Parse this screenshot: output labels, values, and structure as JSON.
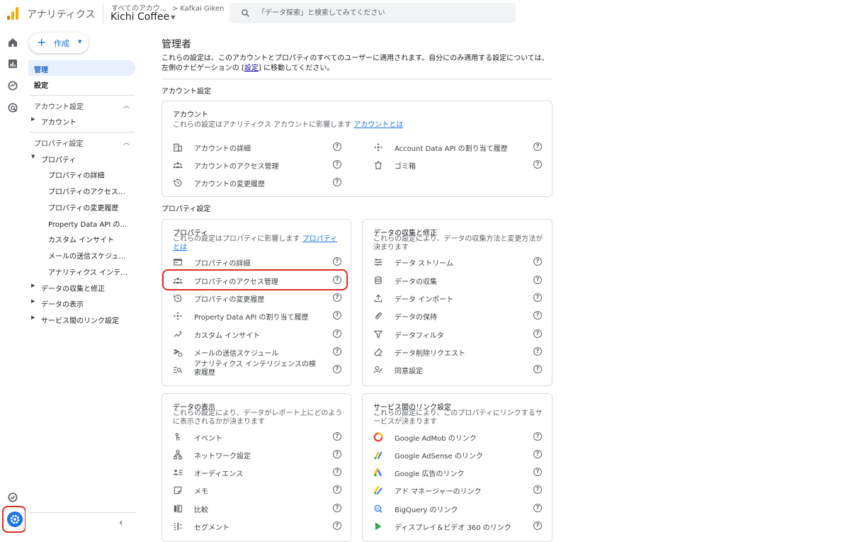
{
  "app": {
    "name": "アナリティクス"
  },
  "account_switcher": {
    "breadcrumb_all": "すべてのアカウ…",
    "breadcrumb_account": "Kafkai Giken",
    "property": "Kichi Coffee"
  },
  "search": {
    "placeholder": "「データ探索」と検索してみてください"
  },
  "colors": {
    "accent": "#1a73e8",
    "highlight": "#d93025",
    "logo_orange": "#f9ab00",
    "logo_dark": "#e37400"
  },
  "sidebar": {
    "create_label": "作成",
    "items": {
      "admin": "管理",
      "settings": "設定",
      "account_section": "アカウント設定",
      "account": "アカウント",
      "property_section": "プロパティ設定",
      "property": "プロパティ",
      "property_children": [
        "プロパティの詳細",
        "プロパティのアクセス…",
        "プロパティの変更履歴",
        "Property Data API の…",
        "カスタム インサイト",
        "メールの送信スケジュ…",
        "アナリティクス インテ…"
      ],
      "data_collection": "データの収集と修正",
      "data_display": "データの表示",
      "product_links": "サービス間のリンク設定"
    }
  },
  "main": {
    "title": "管理者",
    "intro_before": "これらの設定は、このアカウントとプロパティのすべてのユーザーに適用されます。自分にのみ適用する設定については、左側のナビゲーションの [",
    "intro_link": "設定",
    "intro_after": "] に移動してください。",
    "account_section_title": "アカウント設定",
    "property_section_title": "プロパティ設定",
    "account_card": {
      "title": "アカウント",
      "desc": "これらの設定はアナリティクス アカウントに影響します",
      "link": "アカウントとは",
      "left": [
        "アカウントの詳細",
        "アカウントのアクセス管理",
        "アカウントの変更履歴"
      ],
      "right": [
        "Account Data API の割り当て履歴",
        "ゴミ箱"
      ]
    },
    "property_card": {
      "title": "プロパティ",
      "desc": "これらの設定はプロパティに影響します",
      "link": "プロパティとは",
      "items": [
        "プロパティの詳細",
        "プロパティのアクセス管理",
        "プロパティの変更履歴",
        "Property Data API の割り当て履歴",
        "カスタム インサイト",
        "メールの送信スケジュール",
        "アナリティクス インテリジェンスの検索履歴"
      ]
    },
    "data_collection_card": {
      "title": "データの収集と修正",
      "desc": "これらの設定により、データの収集方法と変更方法が決まります",
      "items": [
        "データ ストリーム",
        "データの収集",
        "データ インポート",
        "データの保持",
        "データフィルタ",
        "データ削除リクエスト",
        "同意設定"
      ]
    },
    "data_display_card": {
      "title": "データの表示",
      "desc": "これらの設定により、データがレポート上にどのように表示されるかが決まります",
      "items": [
        "イベント",
        "ネットワーク設定",
        "オーディエンス",
        "メモ",
        "比較",
        "セグメント"
      ]
    },
    "product_links_card": {
      "title": "サービス間のリンク設定",
      "desc": "これらの設定により、このプロパティにリンクするサービスが決まります",
      "items": [
        "Google AdMob のリンク",
        "Google AdSense のリンク",
        "Google 広告のリンク",
        "アド マネージャーのリンク",
        "BigQuery のリンク",
        "ディスプレイ＆ビデオ 360 のリンク"
      ]
    },
    "help_glyph": "?"
  }
}
